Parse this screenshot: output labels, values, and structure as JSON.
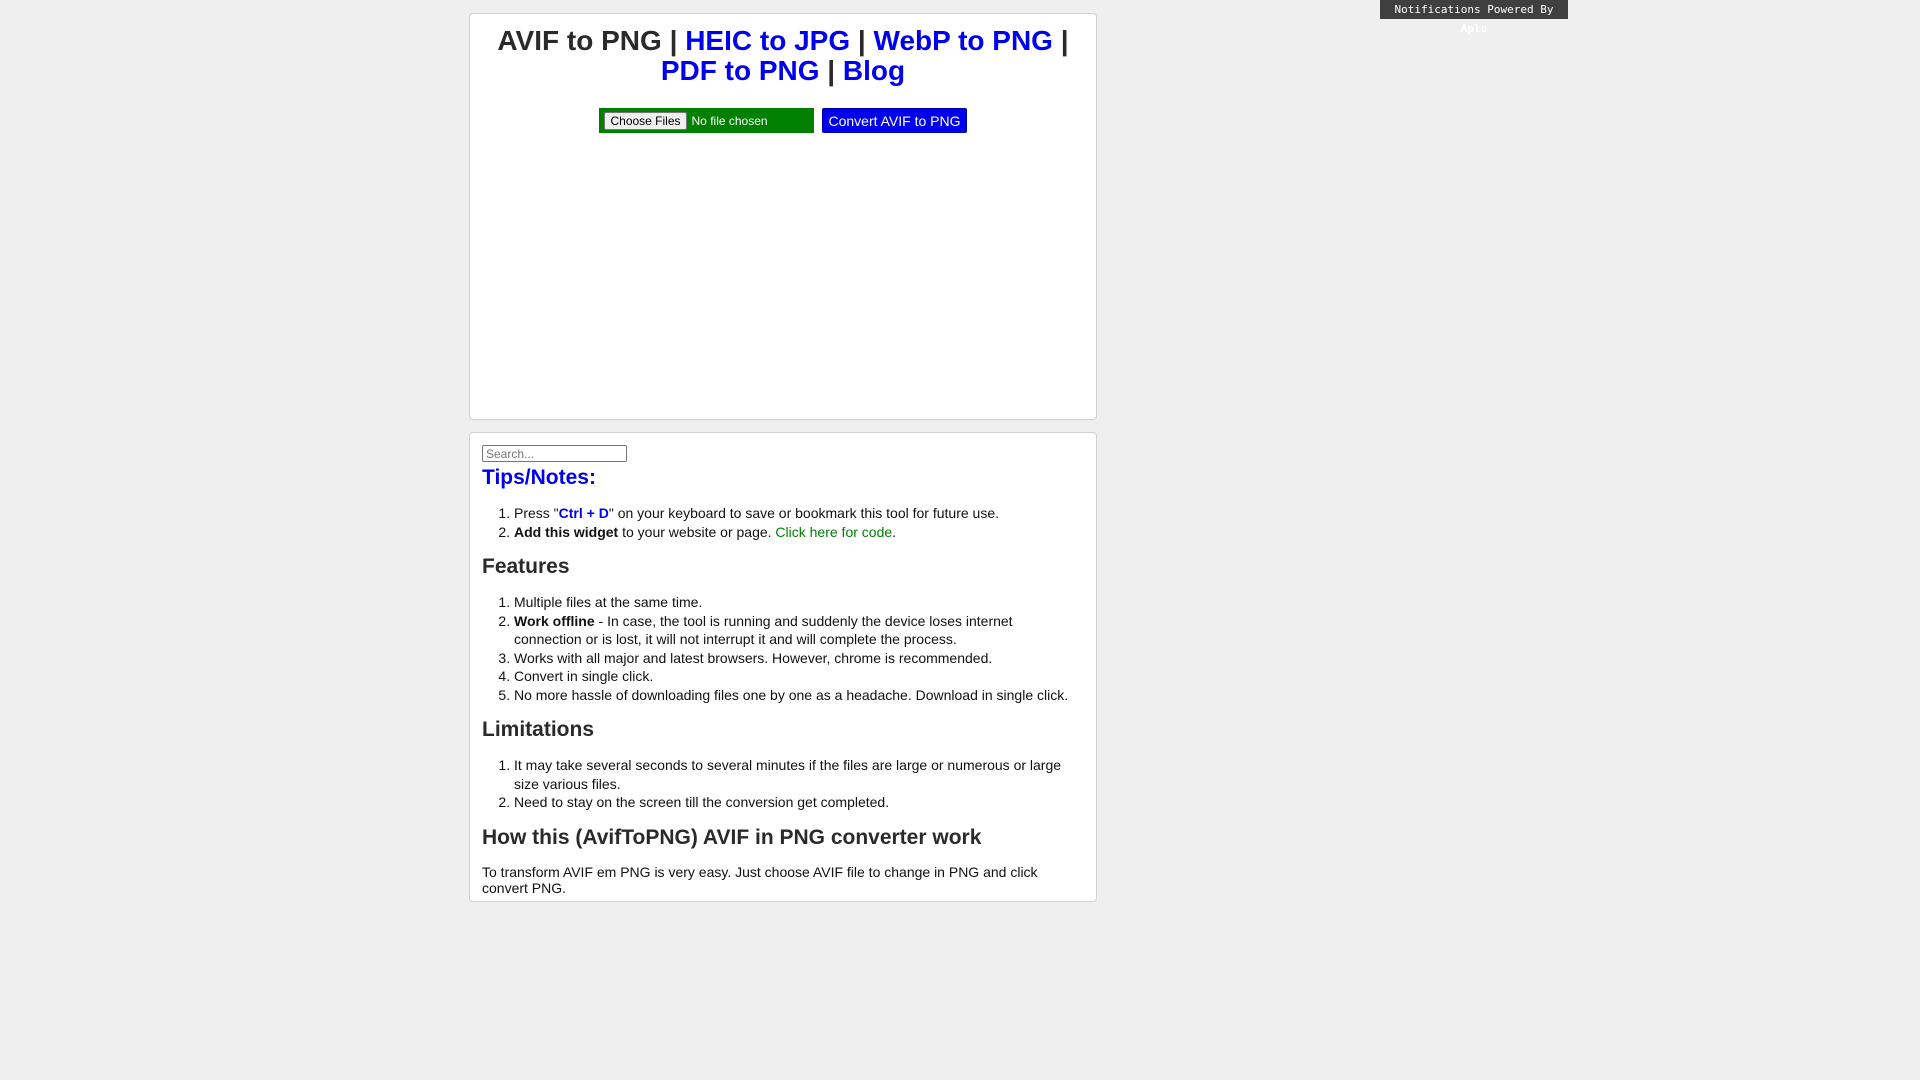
{
  "notification": {
    "prefix": "Notifications Powered By",
    "brand": "Aplu"
  },
  "header": {
    "title_plain": "AVIF to PNG",
    "sep": "|",
    "links": [
      "HEIC to JPG",
      "WebP to PNG",
      "PDF to PNG",
      "Blog"
    ]
  },
  "upload": {
    "choose_label": "Choose Files",
    "no_file_text": "No file chosen",
    "convert_label": "Convert AVIF to PNG"
  },
  "search": {
    "placeholder": "Search..."
  },
  "tips": {
    "heading": "Tips/Notes:",
    "item1_pre": "Press \"",
    "item1_key": "Ctrl + D",
    "item1_post": "\" on your keyboard to save or bookmark this tool for future use.",
    "item2_bold": "Add this widget",
    "item2_mid": " to your website or page. ",
    "item2_link": "Click here for code",
    "item2_end": "."
  },
  "features": {
    "heading": "Features",
    "item1": "Multiple files at the same time.",
    "item2_bold": "Work offline",
    "item2_rest": " - In case, the tool is running and suddenly the device loses internet connection or is lost, it will not interrupt it and will complete the process.",
    "item3": "Works with all major and latest browsers. However, chrome is recommended.",
    "item4": "Convert in single click.",
    "item5": "No more hassle of downloading files one by one as a headache. Download in single click."
  },
  "limitations": {
    "heading": "Limitations",
    "item1": "It may take several seconds to several minutes if the files are large or numerous or large size various files.",
    "item2": "Need to stay on the screen till the conversion get completed."
  },
  "how": {
    "heading": "How this (AvifToPNG) AVIF in PNG converter work",
    "para": "To transform AVIF em PNG is very easy. Just choose AVIF file to change in PNG and click convert PNG."
  }
}
